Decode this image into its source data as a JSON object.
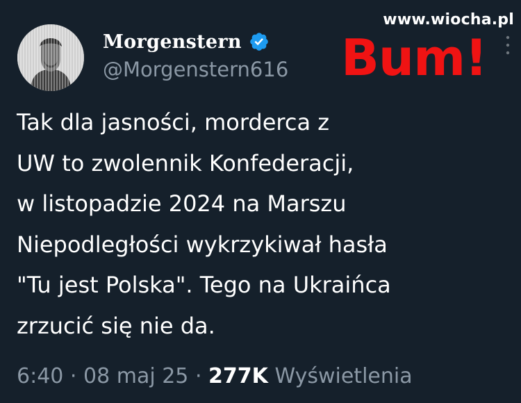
{
  "watermark": "www.wiocha.pl",
  "author": {
    "display_name": "Morgenstern",
    "handle": "@Morgenstern616",
    "verified": true
  },
  "stamp": "Bum!",
  "tweet": {
    "lines": [
      "Tak dla jasności, morderca z",
      "UW to zwolennik Konfederacji,",
      "w listopadzie 2024 na Marszu",
      "Niepodległości wykrzykiwał hasła",
      "\"Tu jest Polska\". Tego na Ukraińca",
      "zrzucić się nie da."
    ]
  },
  "meta": {
    "time": "6:40",
    "separator1": "·",
    "date": "08 maj 25",
    "separator2": "·",
    "views_count": "277K",
    "views_label": "Wyświetlenia"
  },
  "colors": {
    "background": "#15202b",
    "text": "#ffffff",
    "secondary_text": "#8b98a5",
    "verified_badge": "#1d9bf0",
    "stamp": "#f01313"
  },
  "icons": {
    "verified": "verified-badge-icon",
    "more": "more-options-icon"
  }
}
